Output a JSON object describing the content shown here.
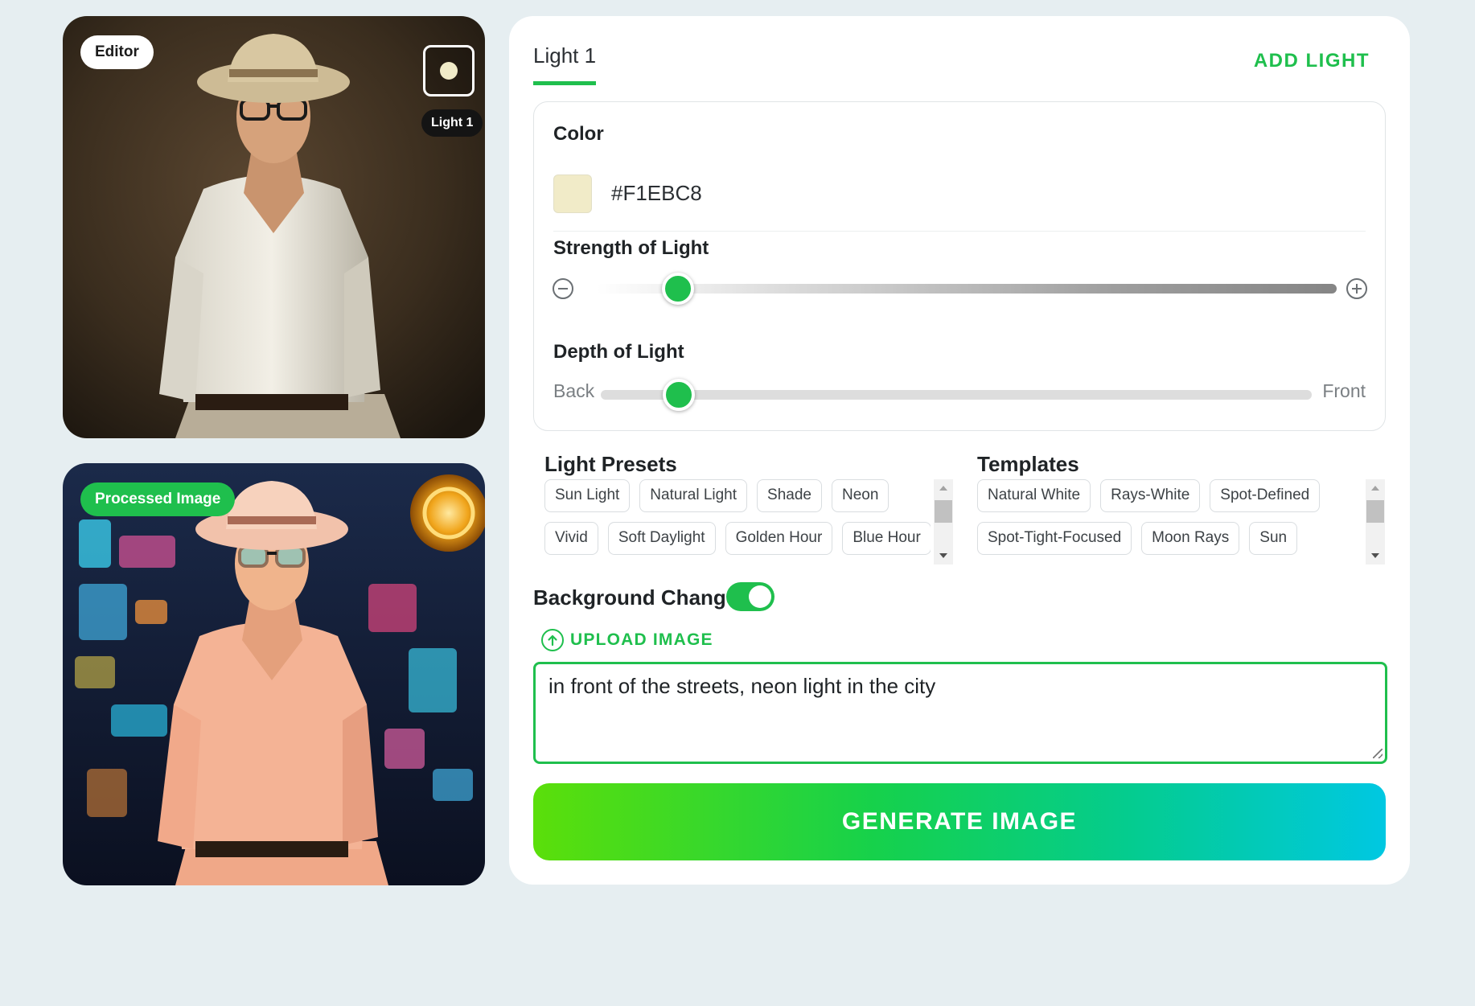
{
  "editor": {
    "tag": "Editor",
    "light_label": "Light 1"
  },
  "processed": {
    "tag": "Processed Image"
  },
  "panel": {
    "tab_label": "Light 1",
    "add_light": "ADD LIGHT",
    "color": {
      "title": "Color",
      "hex": "#F1EBC8"
    },
    "strength": {
      "title": "Strength of Light",
      "value": 0.11
    },
    "depth": {
      "title": "Depth of Light",
      "back_label": "Back",
      "front_label": "Front",
      "value": 0.11
    },
    "presets": {
      "title": "Light Presets",
      "rows": [
        [
          "Sun Light",
          "Natural Light",
          "Shade",
          "Neon"
        ],
        [
          "Vivid",
          "Soft Daylight",
          "Golden Hour",
          "Blue Hour"
        ]
      ]
    },
    "templates": {
      "title": "Templates",
      "rows": [
        [
          "Natural White",
          "Rays-White",
          "Spot-Defined"
        ],
        [
          "Spot-Tight-Focused",
          "Moon Rays",
          "Sun"
        ]
      ]
    },
    "background": {
      "label": "Background Change",
      "enabled": true,
      "upload_label": "UPLOAD IMAGE",
      "prompt": "in front of the streets, neon light in the city"
    },
    "generate_label": "GENERATE IMAGE"
  },
  "colors": {
    "accent": "#1fbf4d",
    "light_color": "#F1EBC8"
  }
}
